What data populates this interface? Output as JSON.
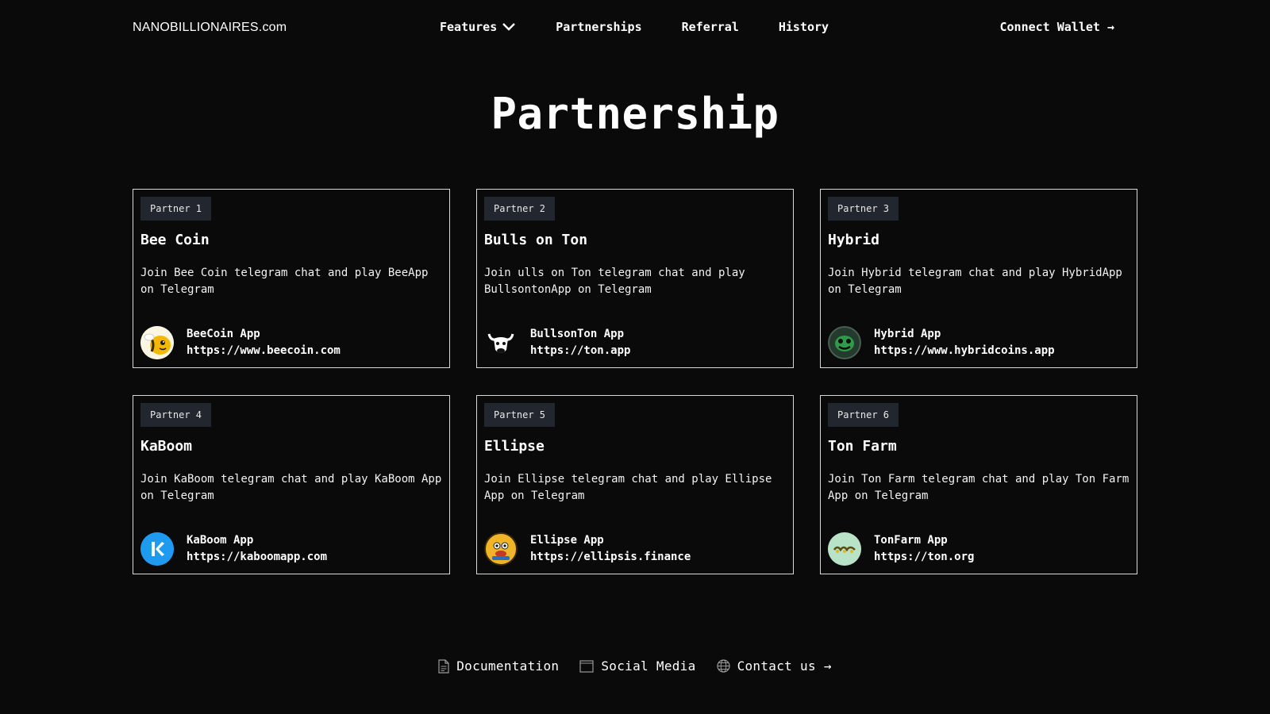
{
  "brand": {
    "logo": "NANOBILLIONAIRES.com"
  },
  "nav": {
    "items": [
      {
        "label": "Features"
      },
      {
        "label": "Partnerships"
      },
      {
        "label": "Referral"
      },
      {
        "label": "History"
      }
    ],
    "connect_label": "Connect Wallet →"
  },
  "page": {
    "title": "Partnership"
  },
  "partners": [
    {
      "badge": "Partner 1",
      "name": "Bee Coin",
      "description": "Join Bee Coin telegram chat and play BeeApp on Telegram",
      "app_name": "BeeCoin App",
      "app_url": "https://www.beecoin.com",
      "icon": "bee-icon"
    },
    {
      "badge": "Partner 2",
      "name": "Bulls on Ton",
      "description": "Join ulls on Ton telegram chat and play BullsontonApp on Telegram",
      "app_name": "BullsonTon App",
      "app_url": "https://ton.app",
      "icon": "bull-icon"
    },
    {
      "badge": "Partner 3",
      "name": "Hybrid",
      "description": "Join Hybrid telegram chat and play HybridApp on Telegram",
      "app_name": "Hybrid App",
      "app_url": "https://www.hybridcoins.app",
      "icon": "hybrid-face-icon"
    },
    {
      "badge": "Partner 4",
      "name": "KaBoom",
      "description": "Join KaBoom telegram chat and play KaBoom App on Telegram",
      "app_name": "KaBoom App",
      "app_url": "https://kaboomapp.com",
      "icon": "kaboom-k-icon"
    },
    {
      "badge": "Partner 5",
      "name": "Ellipse",
      "description": "Join Ellipse telegram chat and play Ellipse App on Telegram",
      "app_name": "Ellipse App",
      "app_url": "https://ellipsis.finance",
      "icon": "ellipse-mascot-icon"
    },
    {
      "badge": "Partner 6",
      "name": "Ton Farm",
      "description": "Join Ton Farm telegram chat and play Ton Farm App on Telegram",
      "app_name": "TonFarm App",
      "app_url": "https://ton.org",
      "icon": "tonfarm-icon"
    }
  ],
  "footer": {
    "links": [
      {
        "label": "Documentation",
        "icon": "document-icon"
      },
      {
        "label": "Social Media",
        "icon": "window-icon"
      },
      {
        "label": "Contact us →",
        "icon": "globe-icon"
      }
    ]
  },
  "colors": {
    "background": "#0a0a0b",
    "card_border": "#d9d9d9",
    "badge_bg": "#22262f",
    "kaboom_blue": "#1e9bf0",
    "tonfarm_green": "#b9e3c6"
  }
}
